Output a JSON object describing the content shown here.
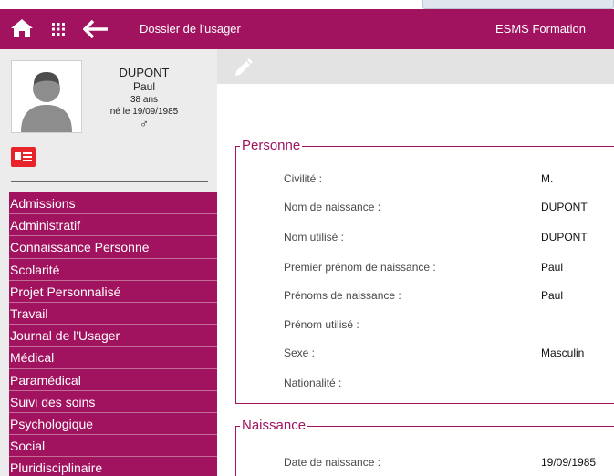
{
  "header": {
    "title": "Dossier de l'usager",
    "organisation": "ESMS Formation"
  },
  "patient": {
    "last_name": "DUPONT",
    "first_name": "Paul",
    "age": "38 ans",
    "birth": "né le 19/09/1985",
    "sex_symbol": "♂"
  },
  "menu": [
    "Admissions",
    "Administratif",
    "Connaissance Personne",
    "Scolarité",
    "Projet Personnalisé",
    "Travail",
    "Journal de l'Usager",
    "Médical",
    "Paramédical",
    "Suivi des soins",
    "Psychologique",
    "Social",
    "Pluridisciplinaire"
  ],
  "sections": {
    "person": {
      "legend": "Personne",
      "fields": [
        {
          "label": "Civilité :",
          "value": "M."
        },
        {
          "label": "Nom de naissance :",
          "value": "DUPONT"
        },
        {
          "label": "Nom utilisé :",
          "value": "DUPONT"
        },
        {
          "label": "Premier prénom de naissance :",
          "value": "Paul"
        },
        {
          "label": "Prénoms de naissance :",
          "value": "Paul"
        },
        {
          "label": "Prénom utilisé :",
          "value": ""
        },
        {
          "label": "Sexe :",
          "value": "Masculin"
        },
        {
          "label": "Nationalité :",
          "value": ""
        }
      ]
    },
    "birth": {
      "legend": "Naissance",
      "fields": [
        {
          "label": "Date de naissance :",
          "value": "19/09/1985"
        }
      ]
    }
  },
  "colors": {
    "brand": "#a1125f",
    "toolbar": "#e3e3e3",
    "sidebar": "#ececec"
  }
}
